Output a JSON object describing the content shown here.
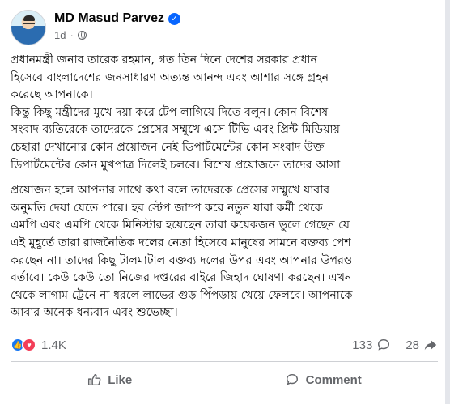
{
  "author": {
    "name": "MD Masud Parvez",
    "time": "1d",
    "dot": "·"
  },
  "post": {
    "paragraph1": "প্রধানমন্ত্রী জনাব তারেক রহমান, গত তিন দিনে দেশের সরকার প্রধান\nহিসেবে বাংলাদেশের জনসাধারণ অত্যন্ত আনন্দ এবং আশার সঙ্গে গ্রহন\nকরেছে আপনাকে।\nকিন্তু কিছু মন্ত্রীদের মুখে দয়া করে টেপ লাগিয়ে দিতে বলুন। কোন বিশেষ\nসংবাদ ব্যতিরেকে তাদেরকে প্রেসের সম্মুখে এসে টিভি এবং প্রিন্ট মিডিয়ায়\nচেহারা দেখানোর কোন প্রয়োজন নেই ডিপার্টমেন্টের কোন সংবাদ উক্ত\nডিপার্টমেন্টের কোন মুখপাত্র দিলেই চলবে। বিশেষ প্রয়োজনে তাদের আসা",
    "paragraph2": " প্রয়োজন হলে আপনার সাথে কথা বলে তাদেরকে প্রেসের সম্মুখে যাবার\nঅনুমতি দেয়া যেতে পারে। হব স্টেপ জাম্প করে নতুন যারা কর্মী থেকে\nএমপি এবং এমপি থেকে মিনিস্টার হয়েছেন তারা কয়েকজন ভুলে গেছেন যে\nএই মুহূর্তে তারা রাজনৈতিক দলের নেতা হিসেবে মানুষের সামনে বক্তব্য পেশ\nকরছেন না। তাদের কিছু টালমাটাল বক্তব্য দলের উপর এবং আপনার উপরও\nবর্তাবে। কেউ কেউ তো নিজের দপ্তরের বাইরে জিহাদ ঘোষণা করছেন। এখন\nথেকে লাগাম ট্রেনে না ধরলে লাভের গুড় পিঁপড়ায় খেয়ে ফেলবে। আপনাকে\nআবার অনেক ধন্যবাদ এবং শুভেচ্ছা।"
  },
  "stats": {
    "reactions": "1.4K",
    "comments": "133",
    "shares": "28"
  },
  "actions": {
    "like": "Like",
    "comment": "Comment"
  },
  "colors": {
    "accent": "#0866ff",
    "like": "#1877f2",
    "love": "#f33e58",
    "muted": "#65676b"
  },
  "icons": [
    "globe-icon",
    "verified-badge-icon",
    "like-reaction-icon",
    "love-reaction-icon",
    "comment-icon",
    "share-icon",
    "thumbs-up-icon",
    "speech-bubble-icon"
  ]
}
